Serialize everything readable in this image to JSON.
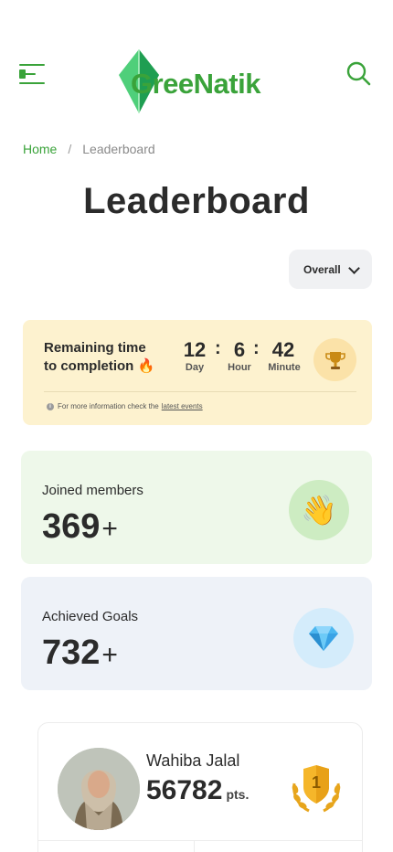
{
  "header": {
    "logo_text": "GreeNatik"
  },
  "breadcrumb": {
    "home": "Home",
    "separator": "/",
    "current": "Leaderboard"
  },
  "page": {
    "title": "Leaderboard"
  },
  "filter": {
    "selected": "Overall"
  },
  "timer": {
    "label_line1": "Remaining time",
    "label_line2": "to completion",
    "days": "12",
    "days_label": "Day",
    "hours": "6",
    "hours_label": "Hour",
    "minutes": "42",
    "minutes_label": "Minute",
    "colon": ":",
    "info_text": "For more information check the",
    "info_link": "latest events"
  },
  "stats": {
    "members_label": "Joined members",
    "members_value": "369",
    "members_suffix": "+",
    "goals_label": "Achieved Goals",
    "goals_value": "732",
    "goals_suffix": "+"
  },
  "top_user": {
    "name": "Wahiba Jalal",
    "points": "56782",
    "points_unit": "pts.",
    "rank": "1"
  },
  "colors": {
    "accent": "#3aa33a",
    "timer_bg": "#fdf2cf",
    "members_bg": "#eef8ea",
    "goals_bg": "#eef2f8"
  },
  "icons": [
    "menu-icon",
    "logo-leaf-icon",
    "search-icon",
    "chevron-down-icon",
    "fire-icon",
    "trophy-icon",
    "info-icon",
    "waving-hand-icon",
    "diamond-icon",
    "rank-medal-icon"
  ]
}
